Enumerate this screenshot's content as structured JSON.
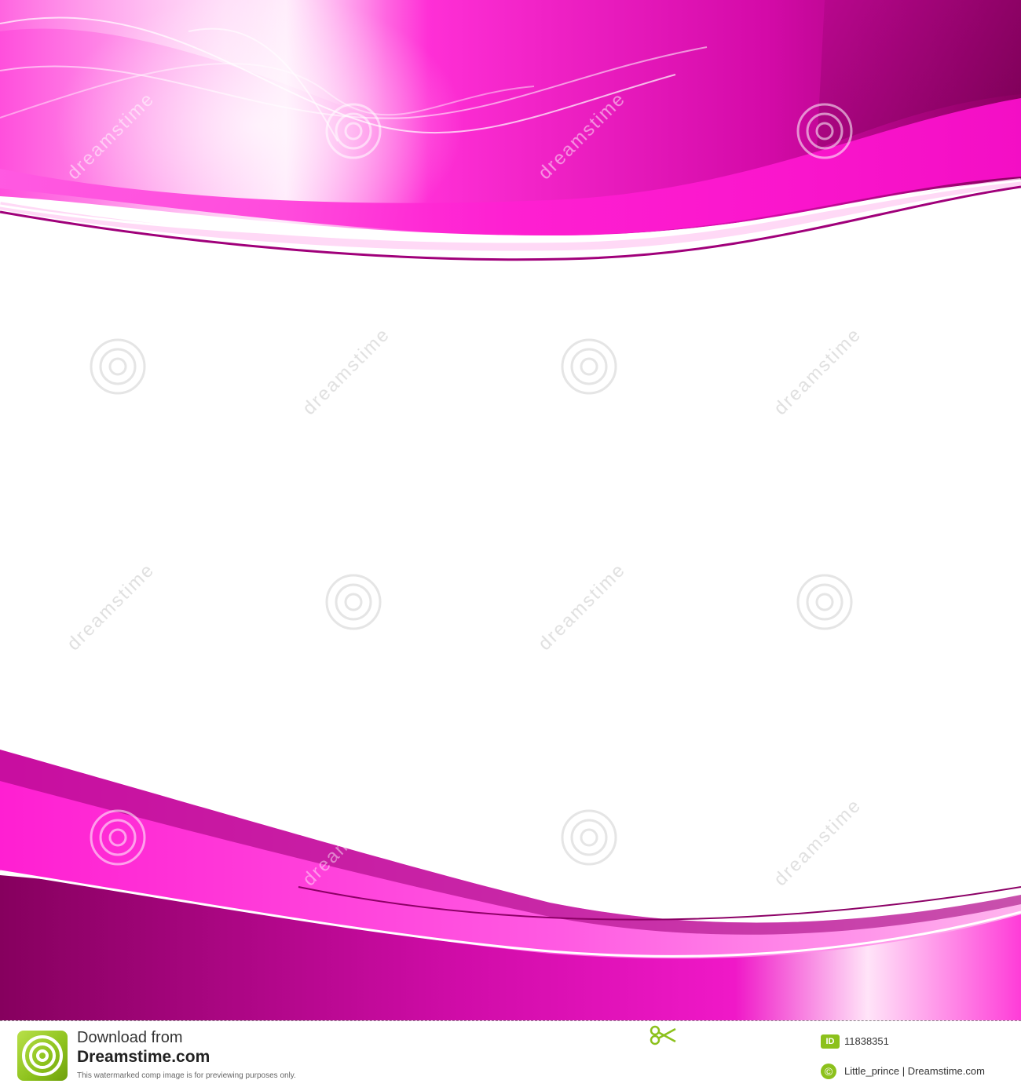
{
  "colors": {
    "magenta_bright": "#ff1fd2",
    "magenta_mid": "#e010b8",
    "magenta_dark": "#8a0060",
    "pink_light": "#ffc8f2",
    "footer_green": "#8cc11c"
  },
  "watermark": {
    "text": "dreamstime"
  },
  "footer": {
    "download_label": "Download from",
    "brand": "Dreamstime.com",
    "disclaimer": "This watermarked comp image is for previewing purposes only.",
    "id_badge": "ID",
    "id_number": "11838351",
    "copyright_symbol": "©",
    "credit": "Little_prince | Dreamstime.com",
    "icons": [
      "dreamstime-logo-icon",
      "scissors-icon",
      "copyright-icon"
    ]
  }
}
